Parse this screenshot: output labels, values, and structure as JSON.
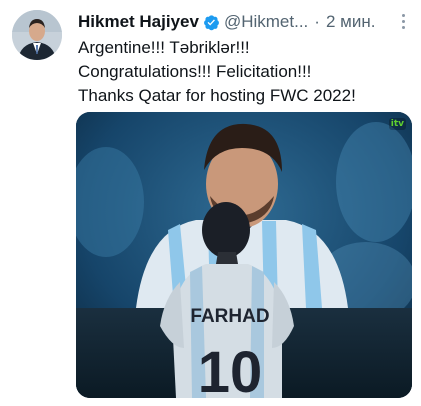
{
  "tweet": {
    "author_name": "Hikmet Hajiyev",
    "handle": "@Hikmet...",
    "separator": "·",
    "time": "2 мин.",
    "text_lines": [
      "Argentine!!! Təbriklər!!!",
      "Congratulations!!! Felicitation!!!",
      "Thanks Qatar for hosting FWC 2022!"
    ],
    "media": {
      "jersey_name": "FARHAD",
      "jersey_number": "10",
      "watermark": "itv"
    }
  },
  "icons": {
    "verified": "verified-badge-icon",
    "more": "more-options-icon"
  },
  "colors": {
    "verified_blue": "#1d9bf0",
    "secondary_text": "#536471",
    "stadium_blue": "#0b2c47",
    "argentina_sky": "#8fc7ea"
  }
}
